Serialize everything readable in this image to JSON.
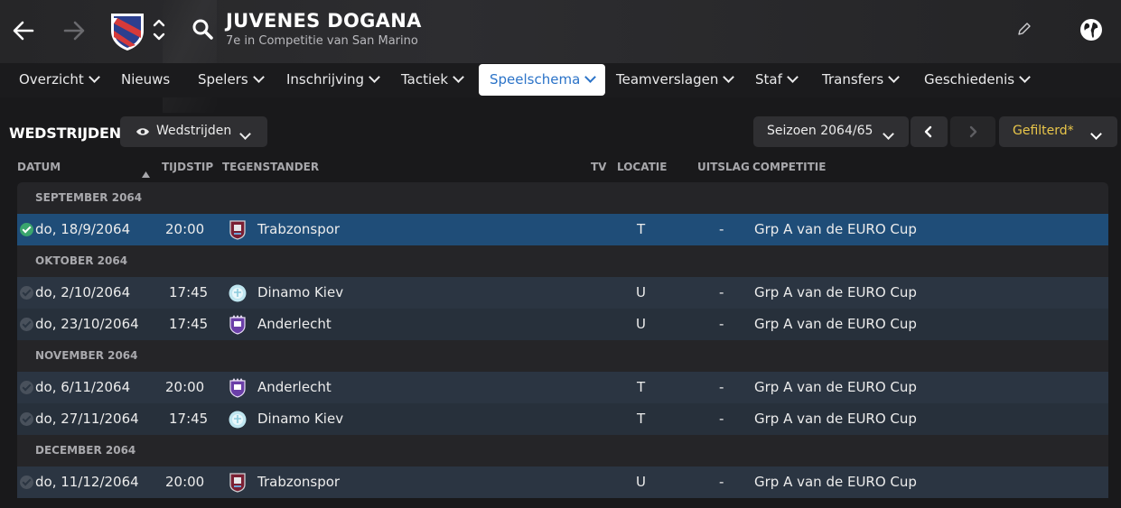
{
  "header": {
    "title": "JUVENES DOGANA",
    "subtitle": "7e in Competitie van San Marino",
    "colors": {
      "accent": "#2b73c8",
      "selected_row": "#1f4d78",
      "gold": "#e9c64a"
    }
  },
  "tabs": [
    {
      "label": "Overzicht",
      "dropdown": true
    },
    {
      "label": "Nieuws",
      "dropdown": false
    },
    {
      "label": "Spelers",
      "dropdown": true
    },
    {
      "label": "Inschrijving",
      "dropdown": true
    },
    {
      "label": "Tactiek",
      "dropdown": true
    },
    {
      "label": "Speelschema",
      "dropdown": true,
      "active": true
    },
    {
      "label": "Teamverslagen",
      "dropdown": true
    },
    {
      "label": "Staf",
      "dropdown": true
    },
    {
      "label": "Transfers",
      "dropdown": true
    },
    {
      "label": "Geschiedenis",
      "dropdown": true
    }
  ],
  "toolbar": {
    "section_title": "WEDSTRIJDEN",
    "view_button": "Wedstrijden",
    "season": "Seizoen 2064/65",
    "filter": "Gefilterd*"
  },
  "columns": {
    "datum": "DATUM",
    "tijdstip": "TIJDSTIP",
    "tegenstander": "TEGENSTANDER",
    "tv": "TV",
    "locatie": "LOCATIE",
    "uitslag": "UITSLAG",
    "competitie": "COMPETITIE"
  },
  "groups": [
    {
      "label": "SEPTEMBER 2064"
    },
    {
      "label": "OKTOBER 2064"
    },
    {
      "label": "NOVEMBER 2064"
    },
    {
      "label": "DECEMBER 2064"
    }
  ],
  "matches": [
    {
      "date": "do, 18/9/2064",
      "time": "20:00",
      "opponent": "Trabzonspor",
      "location": "T",
      "result": "-",
      "competition": "Grp A van de EURO Cup"
    },
    {
      "date": "do, 2/10/2064",
      "time": "17:45",
      "opponent": "Dinamo Kiev",
      "location": "U",
      "result": "-",
      "competition": "Grp A van de EURO Cup"
    },
    {
      "date": "do, 23/10/2064",
      "time": "17:45",
      "opponent": "Anderlecht",
      "location": "U",
      "result": "-",
      "competition": "Grp A van de EURO Cup"
    },
    {
      "date": "do, 6/11/2064",
      "time": "20:00",
      "opponent": "Anderlecht",
      "location": "T",
      "result": "-",
      "competition": "Grp A van de EURO Cup"
    },
    {
      "date": "do, 27/11/2064",
      "time": "17:45",
      "opponent": "Dinamo Kiev",
      "location": "T",
      "result": "-",
      "competition": "Grp A van de EURO Cup"
    },
    {
      "date": "do, 11/12/2064",
      "time": "20:00",
      "opponent": "Trabzonspor",
      "location": "U",
      "result": "-",
      "competition": "Grp A van de EURO Cup"
    }
  ]
}
